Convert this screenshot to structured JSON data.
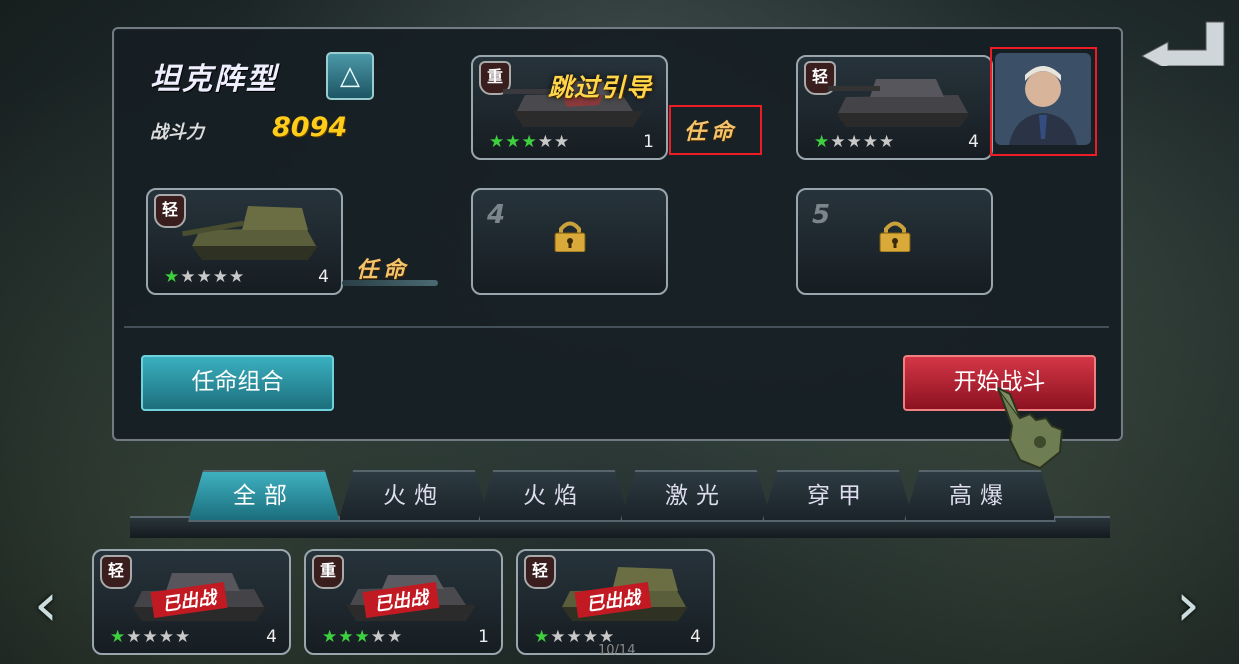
{
  "header": {
    "title": "坦克阵型",
    "power_label": "战斗力",
    "power_value": "8094"
  },
  "guide": {
    "skip_label": "跳过引导"
  },
  "slots": [
    {
      "type": "重",
      "stars_on": 3,
      "stars_total": 5,
      "level": "1",
      "appoint_label": "任命"
    },
    {
      "type": "轻",
      "stars_on": 1,
      "stars_total": 5,
      "level": "4"
    },
    {
      "type": "轻",
      "stars_on": 1,
      "stars_total": 5,
      "level": "4",
      "appoint_label": "任命"
    },
    {
      "slot_number": "4",
      "locked": true
    },
    {
      "slot_number": "5",
      "locked": true
    }
  ],
  "buttons": {
    "combine_label": "任命组合",
    "battle_label": "开始战斗"
  },
  "tabs": [
    "全部",
    "火炮",
    "火焰",
    "激光",
    "穿甲",
    "高爆"
  ],
  "active_tab": "全部",
  "roster": [
    {
      "type": "轻",
      "status": "已出战",
      "stars_on": 1,
      "stars_total": 5,
      "level": "4"
    },
    {
      "type": "重",
      "status": "已出战",
      "stars_on": 3,
      "stars_total": 5,
      "level": "1"
    },
    {
      "type": "轻",
      "status": "已出战",
      "stars_on": 1,
      "stars_total": 5,
      "level": "4"
    }
  ],
  "pagination": {
    "text": "10/14"
  },
  "colors": {
    "accent": "#3ab0c0",
    "battle": "#c82a3a",
    "power": "#ffcc1a",
    "star_on": "#3fd03f",
    "highlight": "#ee1c24"
  },
  "icons": [
    "formation-icon",
    "lock-icon",
    "back-arrow-icon",
    "glove-pointer-icon",
    "chevron-left-icon",
    "chevron-right-icon",
    "commander-portrait"
  ]
}
